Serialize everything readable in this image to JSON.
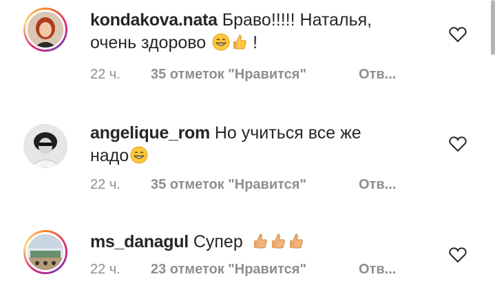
{
  "comments": [
    {
      "username": "kondakova.nata",
      "text_line1": "Браво!!!!! Наталья,",
      "text_line2": "очень здорово",
      "text_line2_suffix": "!",
      "time": "22 ч.",
      "likes": "35 отметок \"Нравится\"",
      "reply": "Отв..."
    },
    {
      "username": "angelique_rom",
      "text_line1": "Но учиться все же",
      "text_line2": "надо",
      "time": "22 ч.",
      "likes": "35 отметок \"Нравится\"",
      "reply": "Отв..."
    },
    {
      "username": "ms_danagul",
      "text_line1": "Супер",
      "time": "22 ч.",
      "likes": "23 отметок \"Нравится\"",
      "reply": "Отв..."
    }
  ],
  "icons": {
    "like": "heart-outline-icon",
    "emoji_grin": "grinning-face-icon",
    "emoji_thumb": "thumbs-up-icon"
  },
  "colors": {
    "text": "#262626",
    "meta": "#8e8e8e",
    "story_ring": "#dd2a7b",
    "emoji_yellow": "#ffc83d"
  }
}
